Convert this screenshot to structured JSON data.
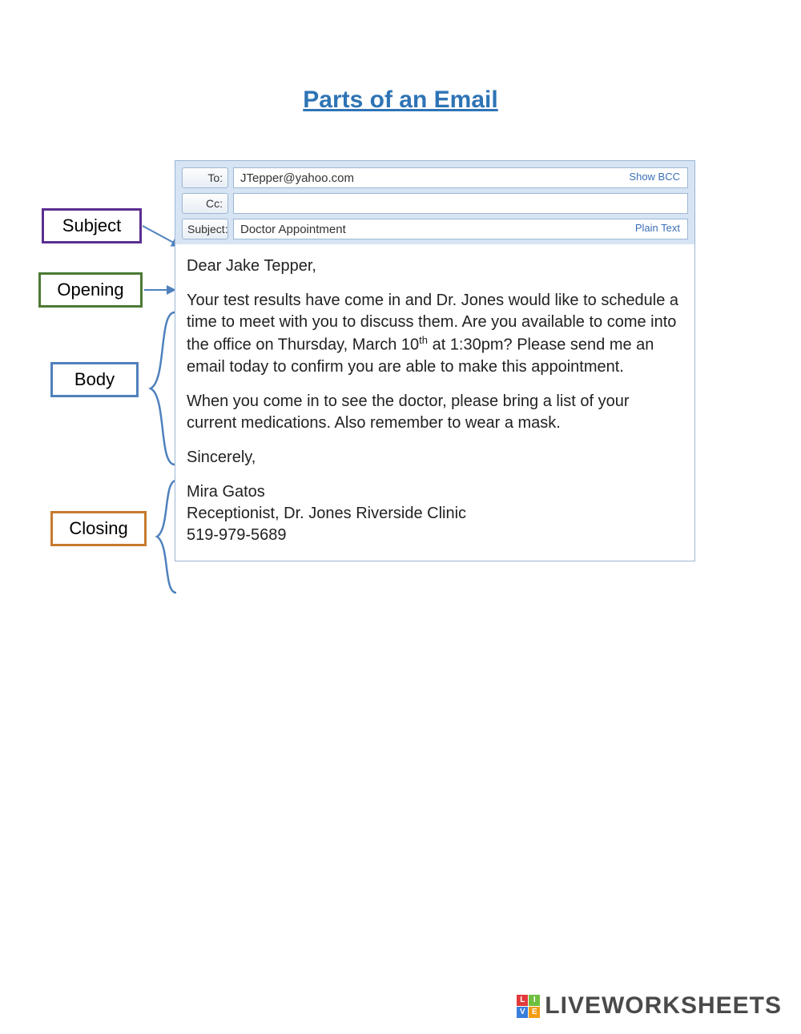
{
  "title": "Parts of an Email",
  "labels": {
    "subject": "Subject",
    "opening": "Opening",
    "body": "Body",
    "closing": "Closing"
  },
  "email": {
    "header": {
      "to_label": "To:",
      "to_value": "JTepper@yahoo.com",
      "show_bcc": "Show BCC",
      "cc_label": "Cc:",
      "cc_value": "",
      "subject_label": "Subject:",
      "subject_value": "Doctor Appointment",
      "plain_text": "Plain Text"
    },
    "body": {
      "opening": "Dear Jake Tepper,",
      "p1a": "Your test results have come in and Dr. Jones would like to schedule a time to meet with you to discuss them.  Are you available to come into the office on Thursday, March 10",
      "p1_sup": "th",
      "p1b": " at 1:30pm? Please send me an email today to confirm you are able to make this appointment.",
      "p2": "When you come in to see the doctor, please bring a list of your current medications.  Also remember to wear a mask.",
      "closing1": "Sincerely,",
      "closing2": "Mira Gatos",
      "closing3": "Receptionist, Dr. Jones Riverside Clinic",
      "closing4": "519-979-5689"
    }
  },
  "brand": {
    "badge": {
      "tl": "L",
      "tr": "I",
      "bl": "V",
      "br": "E"
    },
    "text": "LIVEWORKSHEETS"
  }
}
